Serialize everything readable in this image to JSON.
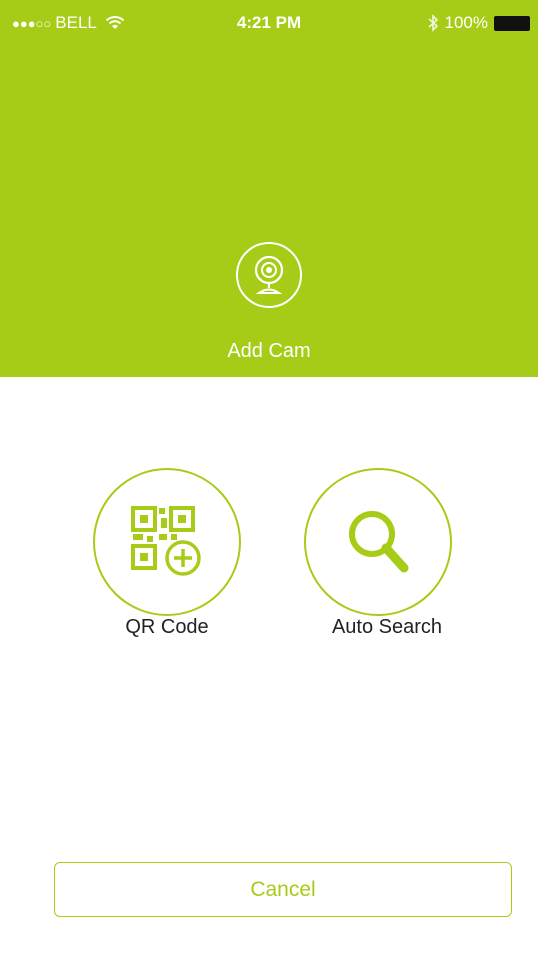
{
  "status_bar": {
    "signal": "●●●○○",
    "carrier": "BELL",
    "time": "4:21 PM",
    "battery": "100%"
  },
  "header": {
    "title": "Add Cam"
  },
  "options": [
    {
      "label": "QR Code",
      "icon": "qr-code-add-icon"
    },
    {
      "label": "Auto Search",
      "icon": "magnifier-icon"
    }
  ],
  "actions": {
    "cancel_label": "Cancel"
  },
  "colors": {
    "accent": "#a6cc17",
    "header_bg": "#a6cc17",
    "text_dark": "#222222",
    "background": "#ffffff"
  }
}
